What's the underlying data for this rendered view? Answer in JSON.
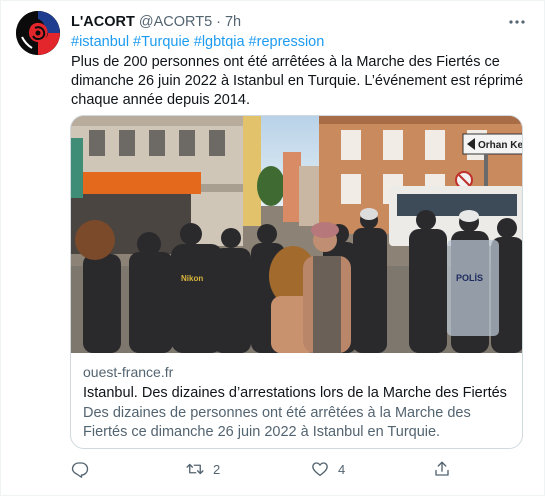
{
  "author": {
    "display_name": "L'ACORT",
    "handle": "@ACORT5",
    "separator": "·",
    "time": "7h"
  },
  "hashtags": [
    "#istanbul",
    "#Turquie",
    "#lgbtqia",
    "#repression"
  ],
  "body": "Plus de 200 personnes ont été arrêtées à la Marche des Fiertés ce dimanche 26 juin 2022 à Istanbul en Turquie. L’événement est réprimé chaque année depuis 2014.",
  "card": {
    "image_signs": {
      "street_sign": "Orhan Ker",
      "police_shield": "POLİS",
      "jacket_print": "Nikon"
    },
    "domain": "ouest-france.fr",
    "title": "Istanbul. Des dizaines d’arrestations lors de la Marche des Fiertés",
    "description": "Des dizaines de personnes ont été arrêtées à la Marche des Fiertés ce dimanche 26 juin 2022 à Istanbul en Turquie."
  },
  "actions": {
    "reply_icon": "reply-icon",
    "retweet_icon": "retweet-icon",
    "retweet_count": "2",
    "like_icon": "heart-icon",
    "like_count": "4",
    "share_icon": "share-icon"
  },
  "colors": {
    "link": "#1d9bf0",
    "secondary_text": "#536471",
    "primary_text": "#0f1419",
    "border": "#cfd9de",
    "avatar_red": "#e3262b",
    "avatar_blue": "#1f3d8f"
  }
}
